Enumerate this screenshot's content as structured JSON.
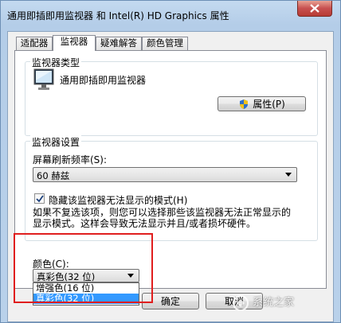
{
  "window": {
    "title": "通用即插即用监视器 和 Intel(R) HD Graphics 属性"
  },
  "tabs": [
    {
      "label": "适配器",
      "active": false
    },
    {
      "label": "监视器",
      "active": true
    },
    {
      "label": "疑难解答",
      "active": false
    },
    {
      "label": "颜色管理",
      "active": false
    }
  ],
  "monitor_type": {
    "group_label": "监视器类型",
    "device_name": "通用即插即用监视器",
    "properties_button": "属性(P)"
  },
  "monitor_settings": {
    "group_label": "监视器设置",
    "refresh_label": "屏幕刷新频率(S):",
    "refresh_value": "60 赫兹",
    "hide_modes_label": "隐藏该监视器无法显示的模式(H)",
    "hide_modes_checked": true,
    "description_line1": "如果不复选该项，则您可以选择那些该监视器无法正常显示的",
    "description_line2": "显示模式。这样会导致无法显示并且/或者损坏硬件。"
  },
  "colors": {
    "label": "颜色(C):",
    "selected": "真彩色(32 位)",
    "options": [
      {
        "label": "增强色(16 位)",
        "highlighted": false
      },
      {
        "label": "真彩色(32 位)",
        "highlighted": true
      }
    ]
  },
  "footer": {
    "ok_button": "确定",
    "cancel_button": "取消"
  },
  "watermark": {
    "text": "系统之家"
  },
  "accent": {
    "highlight_box": "#e01e1e",
    "selection": "#3399ff"
  }
}
